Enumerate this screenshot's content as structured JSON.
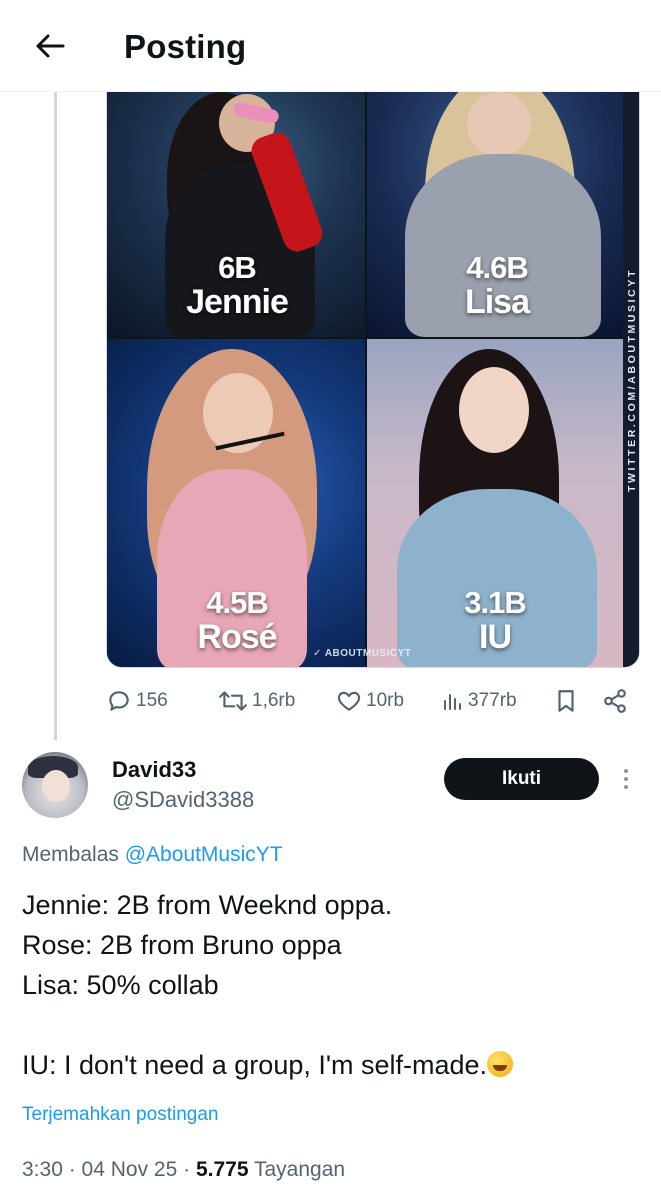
{
  "header": {
    "back_icon": "arrow-left-icon",
    "title": "Posting"
  },
  "media": {
    "watermark_side": "TWITTER.COM/ABOUTMUSICYT",
    "watermark_bottom": "ABOUTMUSICYT",
    "tiles": [
      {
        "value": "6B",
        "name": "Jennie"
      },
      {
        "value": "4.6B",
        "name": "Lisa"
      },
      {
        "value": "4.5B",
        "name": "Rosé"
      },
      {
        "value": "3.1B",
        "name": "IU"
      }
    ]
  },
  "actions": {
    "replies": "156",
    "reposts": "1,6rb",
    "likes": "10rb",
    "views": "377rb"
  },
  "reply": {
    "display_name": "David33",
    "handle": "@SDavid3388",
    "follow_label": "Ikuti",
    "replying_prefix": "Membalas",
    "replying_to": "@AboutMusicYT",
    "lines": [
      "Jennie: 2B from Weeknd oppa.",
      "Rose: 2B from Bruno oppa",
      "Lisa: 50% collab",
      "",
      "IU: I don't need a group, I'm self-made."
    ],
    "translate_label": "Terjemahkan postingan",
    "time": "3:30",
    "date": "04 Nov 25",
    "views_count": "5.775",
    "views_label": "Tayangan"
  },
  "colors": {
    "accent": "#1d9bf0",
    "text": "#0f1419",
    "muted": "#536471",
    "follow_bg": "#0f1419"
  }
}
